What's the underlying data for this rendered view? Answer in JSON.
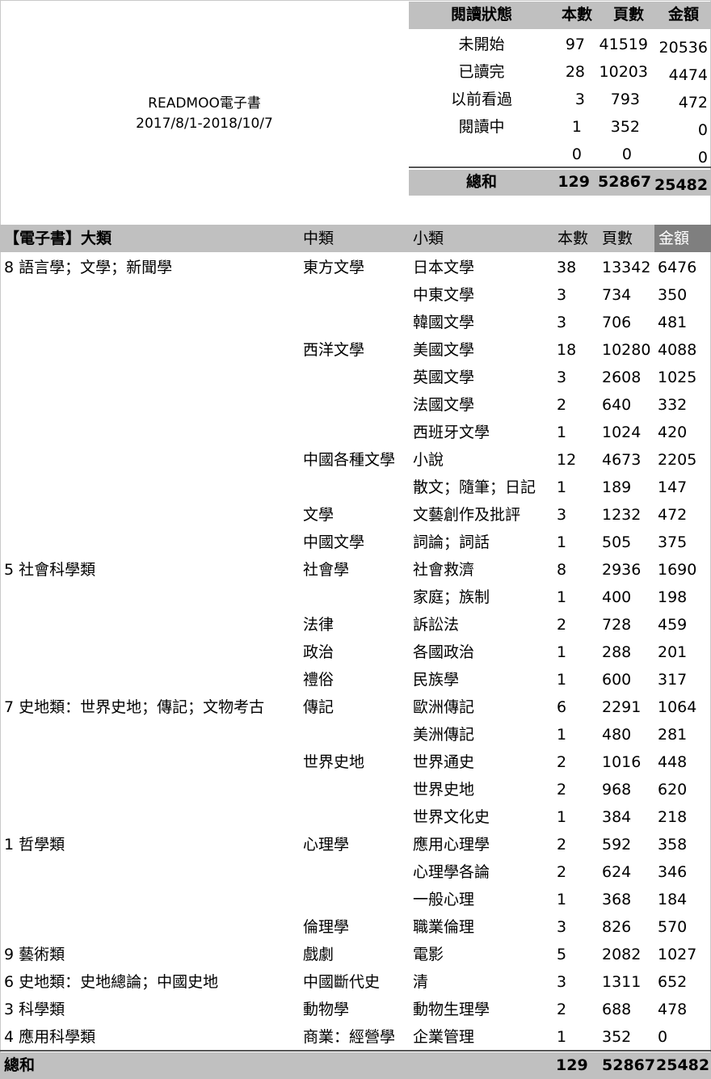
{
  "title": {
    "line1": "READMOO電子書",
    "line2": "2017/8/1-2018/10/7"
  },
  "status_table": {
    "headers": [
      "閱讀狀態",
      "本數",
      "頁數",
      "金額"
    ],
    "rows": [
      {
        "label": "未開始",
        "books": "97",
        "pages": "41519",
        "amount": "20536"
      },
      {
        "label": "已讀完",
        "books": "28",
        "pages": "10203",
        "amount": "4474"
      },
      {
        "label": "以前看過",
        "books": "3",
        "pages": "793",
        "amount": "472"
      },
      {
        "label": "閱讀中",
        "books": "1",
        "pages": "352",
        "amount": "0"
      },
      {
        "label": "",
        "books": "0",
        "pages": "0",
        "amount": "0"
      }
    ],
    "total": {
      "label": "總和",
      "books": "129",
      "pages": "52867",
      "amount": "25482"
    }
  },
  "category_table": {
    "headers": [
      "【電子書】大類",
      "中類",
      "小類",
      "本數",
      "頁數",
      "金額"
    ],
    "rows": [
      {
        "major": "8 語言學；文學；新聞學",
        "mid": "東方文學",
        "minor": "日本文學",
        "books": "38",
        "pages": "13342",
        "amount": "6476"
      },
      {
        "major": "",
        "mid": "",
        "minor": "中東文學",
        "books": "3",
        "pages": "734",
        "amount": "350"
      },
      {
        "major": "",
        "mid": "",
        "minor": "韓國文學",
        "books": "3",
        "pages": "706",
        "amount": "481"
      },
      {
        "major": "",
        "mid": "西洋文學",
        "minor": "美國文學",
        "books": "18",
        "pages": "10280",
        "amount": "4088"
      },
      {
        "major": "",
        "mid": "",
        "minor": "英國文學",
        "books": "3",
        "pages": "2608",
        "amount": "1025"
      },
      {
        "major": "",
        "mid": "",
        "minor": "法國文學",
        "books": "2",
        "pages": "640",
        "amount": "332"
      },
      {
        "major": "",
        "mid": "",
        "minor": "西班牙文學",
        "books": "1",
        "pages": "1024",
        "amount": "420"
      },
      {
        "major": "",
        "mid": "中國各種文學",
        "minor": "小說",
        "books": "12",
        "pages": "4673",
        "amount": "2205"
      },
      {
        "major": "",
        "mid": "",
        "minor": "散文；隨筆；日記",
        "books": "1",
        "pages": "189",
        "amount": "147"
      },
      {
        "major": "",
        "mid": "文學",
        "minor": "文藝創作及批評",
        "books": "3",
        "pages": "1232",
        "amount": "472"
      },
      {
        "major": "",
        "mid": "中國文學",
        "minor": "詞論；詞話",
        "books": "1",
        "pages": "505",
        "amount": "375"
      },
      {
        "major": "5 社會科學類",
        "mid": "社會學",
        "minor": "社會救濟",
        "books": "8",
        "pages": "2936",
        "amount": "1690"
      },
      {
        "major": "",
        "mid": "",
        "minor": "家庭；族制",
        "books": "1",
        "pages": "400",
        "amount": "198"
      },
      {
        "major": "",
        "mid": "法律",
        "minor": "訴訟法",
        "books": "2",
        "pages": "728",
        "amount": "459"
      },
      {
        "major": "",
        "mid": "政治",
        "minor": "各國政治",
        "books": "1",
        "pages": "288",
        "amount": "201"
      },
      {
        "major": "",
        "mid": "禮俗",
        "minor": "民族學",
        "books": "1",
        "pages": "600",
        "amount": "317"
      },
      {
        "major": "7 史地類：世界史地；傳記；文物考古",
        "mid": "傳記",
        "minor": "歐洲傳記",
        "books": "6",
        "pages": "2291",
        "amount": "1064"
      },
      {
        "major": "",
        "mid": "",
        "minor": "美洲傳記",
        "books": "1",
        "pages": "480",
        "amount": "281"
      },
      {
        "major": "",
        "mid": "世界史地",
        "minor": "世界通史",
        "books": "2",
        "pages": "1016",
        "amount": "448"
      },
      {
        "major": "",
        "mid": "",
        "minor": "世界史地",
        "books": "2",
        "pages": "968",
        "amount": "620"
      },
      {
        "major": "",
        "mid": "",
        "minor": "世界文化史",
        "books": "1",
        "pages": "384",
        "amount": "218"
      },
      {
        "major": "1 哲學類",
        "mid": "心理學",
        "minor": "應用心理學",
        "books": "2",
        "pages": "592",
        "amount": "358"
      },
      {
        "major": "",
        "mid": "",
        "minor": "心理學各論",
        "books": "2",
        "pages": "624",
        "amount": "346"
      },
      {
        "major": "",
        "mid": "",
        "minor": "一般心理",
        "books": "1",
        "pages": "368",
        "amount": "184"
      },
      {
        "major": "",
        "mid": "倫理學",
        "minor": "職業倫理",
        "books": "3",
        "pages": "826",
        "amount": "570"
      },
      {
        "major": "9 藝術類",
        "mid": "戲劇",
        "minor": "電影",
        "books": "5",
        "pages": "2082",
        "amount": "1027"
      },
      {
        "major": "6 史地類：史地總論；中國史地",
        "mid": "中國斷代史",
        "minor": "清",
        "books": "3",
        "pages": "1311",
        "amount": "652"
      },
      {
        "major": "3 科學類",
        "mid": "動物學",
        "minor": "動物生理學",
        "books": "2",
        "pages": "688",
        "amount": "478"
      },
      {
        "major": "4 應用科學類",
        "mid": "商業：經營學",
        "minor": "企業管理",
        "books": "1",
        "pages": "352",
        "amount": "0"
      }
    ],
    "total": {
      "label": "總和",
      "books": "129",
      "pages": "52867",
      "amount": "25482"
    }
  },
  "colors": {
    "header_band": "#c0c0c0",
    "amount_header_bg": "#7f7f7f",
    "amount_header_text": "#ffffff",
    "grid": "#c9c9c9"
  }
}
